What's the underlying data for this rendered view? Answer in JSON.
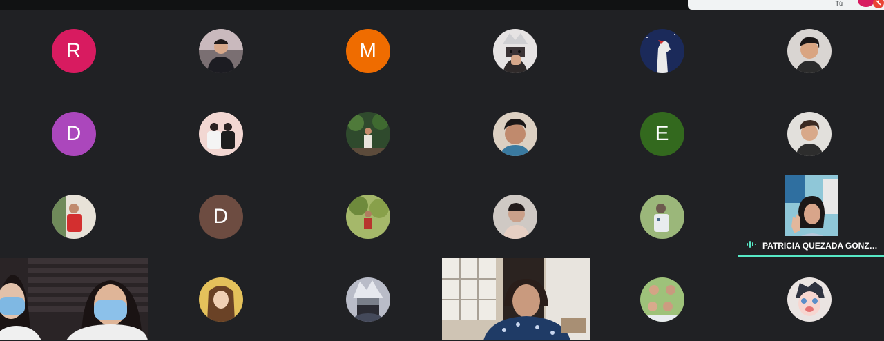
{
  "self_view": {
    "label": "Tú"
  },
  "participants": [
    {
      "type": "letter",
      "letter": "R",
      "color": "#d81b60"
    },
    {
      "type": "photo",
      "icon": "participant-photo"
    },
    {
      "type": "letter",
      "letter": "M",
      "color": "#ef6c00"
    },
    {
      "type": "photo",
      "icon": "participant-photo"
    },
    {
      "type": "photo",
      "icon": "participant-photo"
    },
    {
      "type": "photo",
      "icon": "participant-photo"
    },
    {
      "type": "letter",
      "letter": "D",
      "color": "#ab47bc"
    },
    {
      "type": "photo",
      "icon": "participant-photo"
    },
    {
      "type": "photo",
      "icon": "participant-photo"
    },
    {
      "type": "photo",
      "icon": "participant-photo"
    },
    {
      "type": "letter",
      "letter": "E",
      "color": "#33691e"
    },
    {
      "type": "photo",
      "icon": "participant-photo"
    },
    {
      "type": "photo",
      "icon": "participant-photo"
    },
    {
      "type": "letter",
      "letter": "D",
      "color": "#6d4c41"
    },
    {
      "type": "photo",
      "icon": "participant-photo"
    },
    {
      "type": "photo",
      "icon": "participant-photo"
    },
    {
      "type": "photo",
      "icon": "participant-photo"
    },
    {
      "type": "photo",
      "icon": "participant-photo"
    },
    {
      "type": "photo",
      "icon": "participant-photo"
    },
    {
      "type": "photo",
      "icon": "participant-photo"
    },
    {
      "type": "photo",
      "icon": "participant-photo"
    },
    {
      "type": "photo",
      "icon": "participant-photo"
    }
  ],
  "active_speaker": {
    "name": "PATRICIA QUEZADA GONZA...",
    "accent_color": "#57e8c6"
  }
}
